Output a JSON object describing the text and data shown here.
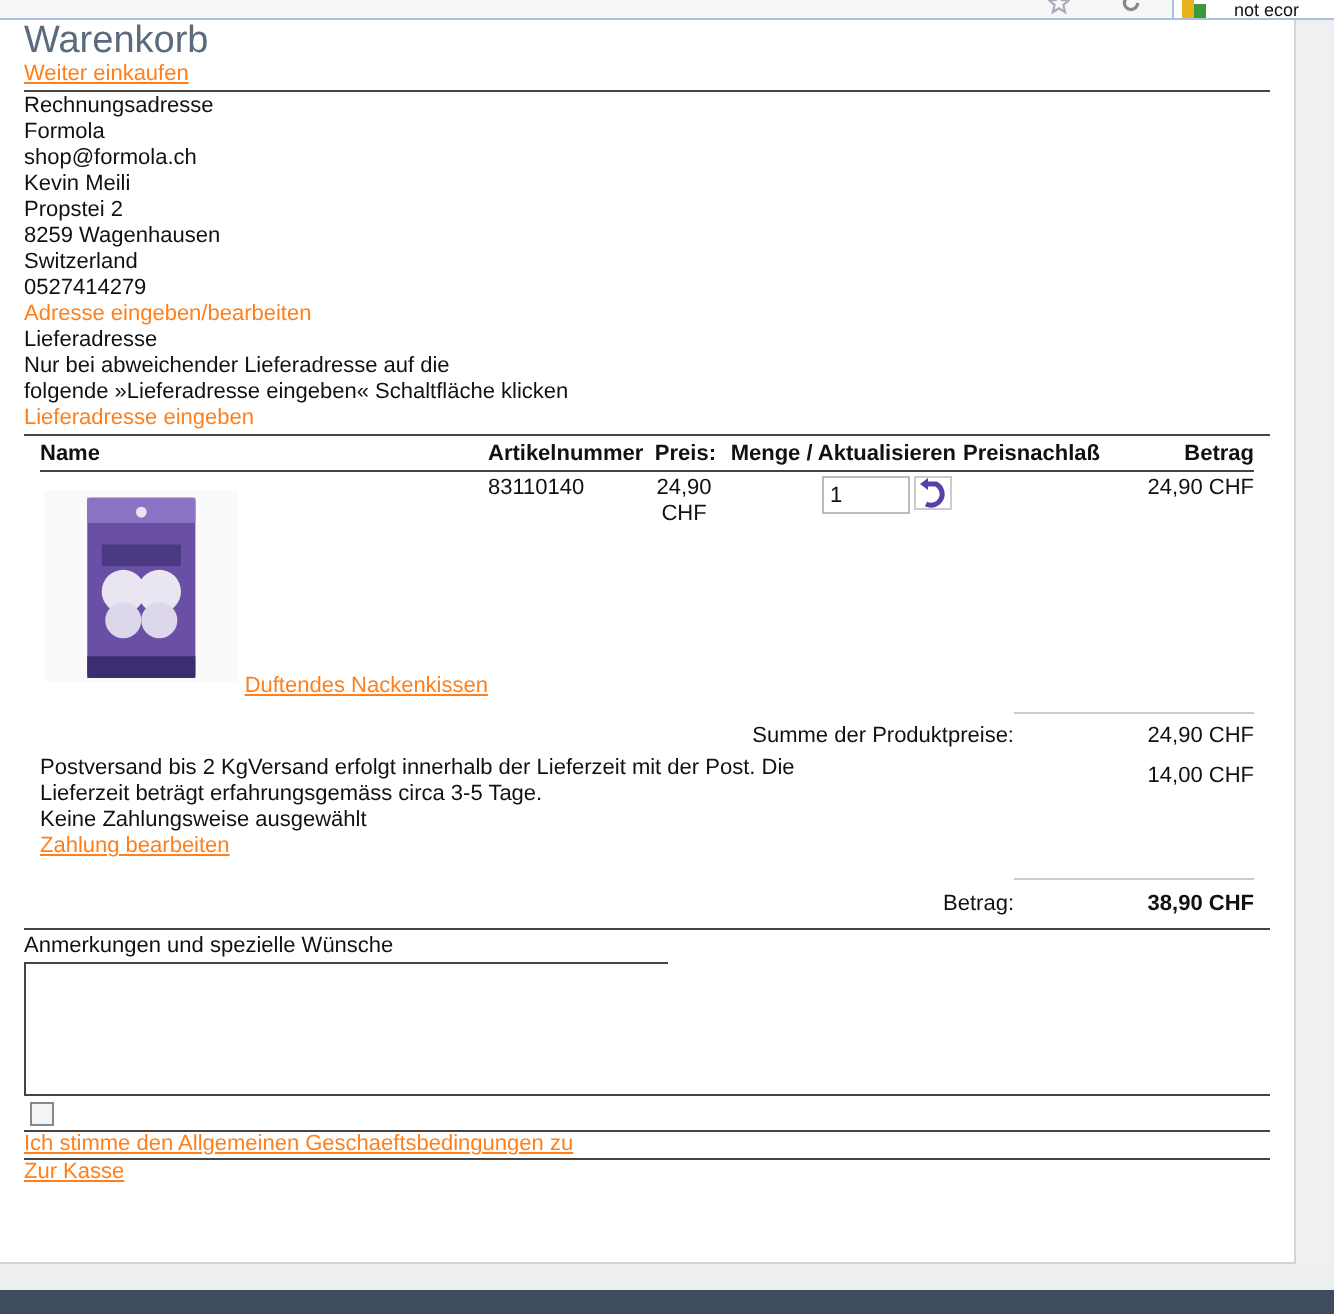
{
  "browser": {
    "tab_text": "not ecor"
  },
  "page": {
    "title": "Warenkorb",
    "continue_link": "Weiter einkaufen",
    "billing": {
      "heading": "Rechnungsadresse",
      "lines": [
        "Formola",
        "shop@formola.ch",
        "Kevin Meili",
        "Propstei 2",
        "8259 Wagenhausen",
        "Switzerland",
        "0527414279"
      ],
      "edit_link": "Adresse eingeben/bearbeiten"
    },
    "shipping": {
      "heading": "Lieferadresse",
      "note_lines": [
        "Nur bei abweichender Lieferadresse auf die",
        "folgende »Lieferadresse eingeben« Schaltfläche klicken"
      ],
      "link": "Lieferadresse eingeben"
    },
    "cart": {
      "columns": [
        "Name",
        "Artikelnummer",
        "Preis:",
        "Menge / Aktualisieren",
        "Preisnachlaß",
        "Betrag"
      ],
      "rows": [
        {
          "name": "Duftendes Nackenkissen",
          "article": "83110140",
          "price": "24,90 CHF",
          "quantity": "1",
          "total": "24,90 CHF"
        }
      ]
    },
    "totals": {
      "subtotal_label": "Summe der Produktpreise:",
      "subtotal": "24,90 CHF",
      "shipping_text": "Postversand bis 2 KgVersand erfolgt innerhalb der Lieferzeit mit der Post. Die Lieferzeit beträgt erfahrungsgemäss circa 3-5 Tage.",
      "shipping_cost": "14,00 CHF",
      "payment_note": "Keine Zahlungsweise ausgewählt",
      "payment_link": "Zahlung bearbeiten",
      "total_label": "Betrag:",
      "total": "38,90 CHF"
    },
    "remarks": {
      "label": "Anmerkungen und spezielle Wünsche"
    },
    "terms": {
      "checked": false,
      "link": "Ich stimme den Allgemeinen Geschaeftsbedingungen zu"
    },
    "checkout_link": "Zur Kasse"
  }
}
